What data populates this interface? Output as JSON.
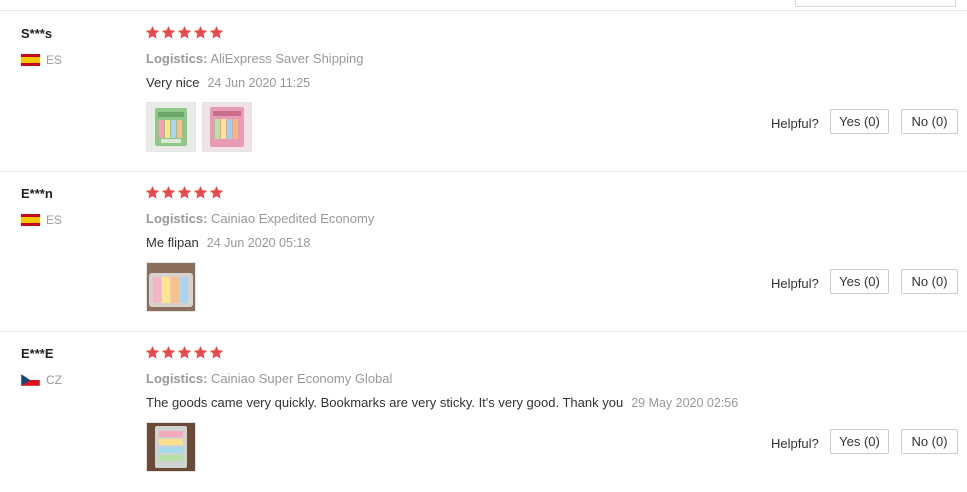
{
  "reviews": [
    {
      "user": "S***s",
      "country": "ES",
      "rating": 5,
      "logistics_label": "Logistics:",
      "logistics": "AliExpress Saver Shipping",
      "text": "Very nice",
      "date": "24 Jun 2020 11:25",
      "photos": [
        "photo-1",
        "photo-2"
      ],
      "helpful_label": "Helpful?",
      "yes_label": "Yes (0)",
      "no_label": "No (0)"
    },
    {
      "user": "E***n",
      "country": "ES",
      "rating": 5,
      "logistics_label": "Logistics:",
      "logistics": "Cainiao Expedited Economy",
      "text": "Me flipan",
      "date": "24 Jun 2020 05:18",
      "photos": [
        "photo-1"
      ],
      "helpful_label": "Helpful?",
      "yes_label": "Yes (0)",
      "no_label": "No (0)"
    },
    {
      "user": "E***E",
      "country": "CZ",
      "rating": 5,
      "logistics_label": "Logistics:",
      "logistics": "Cainiao Super Economy Global",
      "text": "The goods came very quickly. Bookmarks are very sticky. It's very good. Thank you",
      "date": "29 May 2020 02:56",
      "photos": [
        "photo-1"
      ],
      "helpful_label": "Helpful?",
      "yes_label": "Yes (0)",
      "no_label": "No (0)"
    }
  ],
  "colors": {
    "star": "#e84949",
    "muted": "#999999",
    "border": "#e8e8e8"
  }
}
